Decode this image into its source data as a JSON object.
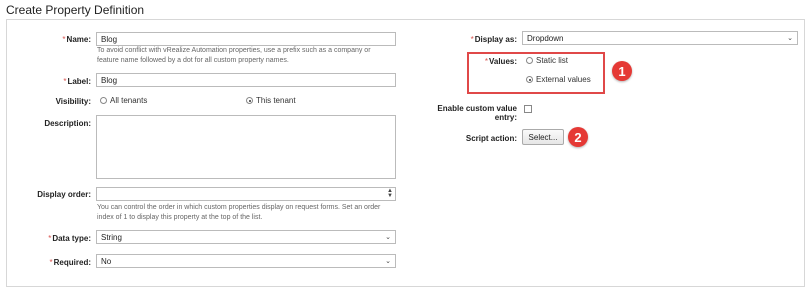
{
  "page": {
    "title": "Create Property Definition"
  },
  "left": {
    "name": {
      "label": "Name:",
      "value": "Blog",
      "help": [
        "To avoid conflict with vRealize Automation properties, use a prefix such as a company or",
        "feature name followed by a dot for all custom property names."
      ]
    },
    "label": {
      "label": "Label:",
      "value": "Blog"
    },
    "visibility": {
      "label": "Visibility:",
      "options": [
        "All tenants",
        "This tenant"
      ],
      "selected": 1
    },
    "description": {
      "label": "Description:",
      "value": ""
    },
    "display_order": {
      "label": "Display order:",
      "value": "",
      "help": [
        "You can control the order in which custom properties display on request forms. Set an order",
        "index of 1 to display this property at the top of the list."
      ]
    },
    "data_type": {
      "label": "Data type:",
      "value": "String"
    },
    "required": {
      "label": "Required:",
      "value": "No"
    }
  },
  "right": {
    "display_as": {
      "label": "Display as:",
      "value": "Dropdown"
    },
    "values": {
      "label": "Values:",
      "options": [
        "Static list",
        "External values"
      ],
      "selected": 1
    },
    "enable_custom": {
      "label_line1": "Enable custom value",
      "label_line2": "entry:"
    },
    "script_action": {
      "label": "Script action:",
      "button": "Select..."
    }
  },
  "callouts": {
    "one": "1",
    "two": "2"
  },
  "colors": {
    "callout_red": "#e53935",
    "required_mark": "#d9534f"
  }
}
